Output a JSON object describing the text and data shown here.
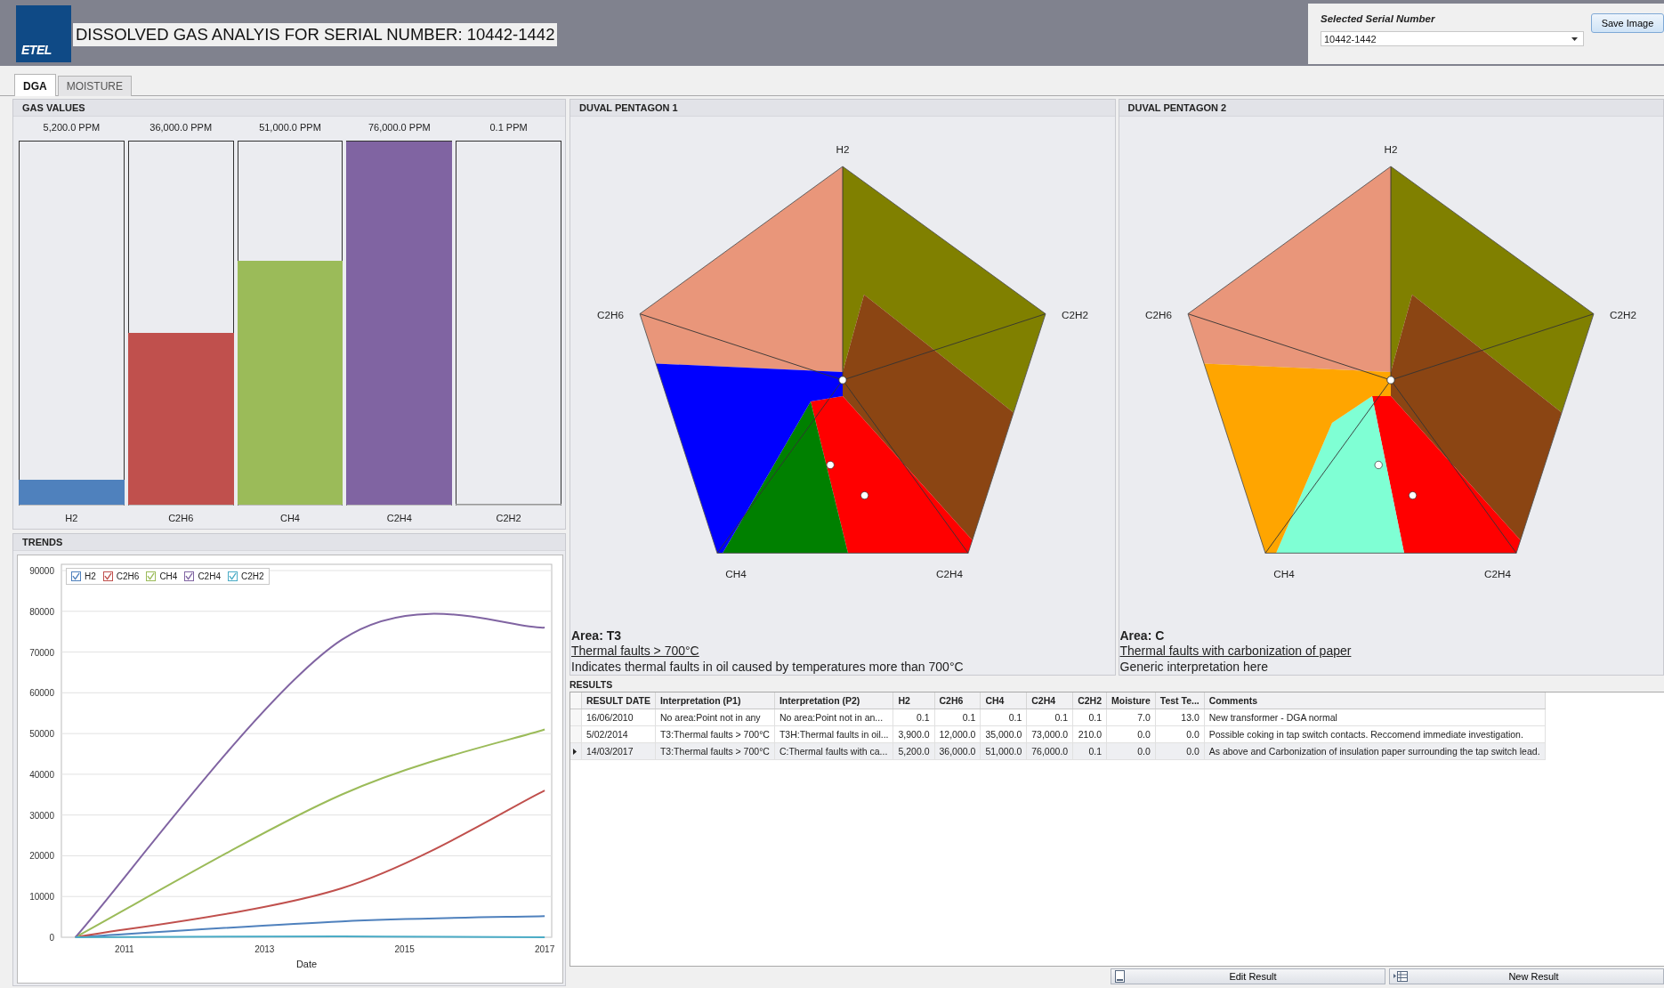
{
  "header": {
    "logo_text": "ETEL",
    "title": "DISSOLVED GAS ANALYIS FOR SERIAL NUMBER: 10442-1442",
    "serial_label": "Selected Serial Number",
    "serial_value": "10442-1442",
    "save_button": "Save Image"
  },
  "tabs": [
    {
      "label": "DGA",
      "selected": true
    },
    {
      "label": "MOISTURE",
      "selected": false
    }
  ],
  "gas_values": {
    "title": "GAS VALUES",
    "bars": [
      {
        "name": "H2",
        "reading": "5,200.0 PPM",
        "level": 0.068,
        "color": "#4f81bd"
      },
      {
        "name": "C2H6",
        "reading": "36,000.0 PPM",
        "level": 0.474,
        "color": "#c0504d"
      },
      {
        "name": "CH4",
        "reading": "51,000.0 PPM",
        "level": 0.671,
        "color": "#9bbb59"
      },
      {
        "name": "C2H4",
        "reading": "76,000.0 PPM",
        "level": 1.0,
        "color": "#8064a2"
      },
      {
        "name": "C2H2",
        "reading": "0.1 PPM",
        "level": 0.0
      }
    ]
  },
  "trends": {
    "title": "TRENDS",
    "legend": [
      {
        "checked": true
      },
      {
        "checked": true
      },
      {
        "checked": true
      },
      {
        "checked": true
      },
      {
        "checked": true
      }
    ],
    "chart_data": {
      "type": "line",
      "xlabel": "Date",
      "x": [
        2010.3,
        2014.1,
        2017.0
      ],
      "xlim": [
        2010.1,
        2017.1
      ],
      "grid": true,
      "legend": true,
      "ylim": [
        0,
        90000
      ],
      "xticks": [
        2011,
        2013,
        2015,
        2017
      ],
      "yticks": [
        0,
        10000,
        20000,
        30000,
        40000,
        50000,
        60000,
        70000,
        80000,
        90000
      ],
      "series": [
        {
          "name": "H2",
          "color": "#4f81bd",
          "values": [
            0,
            3900,
            5200
          ]
        },
        {
          "name": "C2H6",
          "color": "#c0504d",
          "values": [
            0,
            12000,
            36000
          ]
        },
        {
          "name": "CH4",
          "color": "#9bbb59",
          "values": [
            0,
            35000,
            51000
          ]
        },
        {
          "name": "C2H4",
          "color": "#8064a2",
          "values": [
            0,
            73000,
            76000
          ]
        },
        {
          "name": "C2H2",
          "color": "#4bacc6",
          "values": [
            0,
            200,
            0
          ]
        }
      ]
    }
  },
  "pentagons": [
    {
      "title": "DUVAL PENTAGON 1",
      "kind": "p1",
      "vertices": [
        "H2",
        "C2H6",
        "C2H2",
        "CH4",
        "C2H4"
      ],
      "area": "Area: T3",
      "fault": "Thermal faults > 700°C",
      "description": "Indicates thermal faults in oil caused by temperatures more than 700°C"
    },
    {
      "title": "DUVAL PENTAGON 2",
      "kind": "p2",
      "vertices": [
        "H2",
        "C2H6",
        "C2H2",
        "CH4",
        "C2H4"
      ],
      "area": "Area: C",
      "fault": "Thermal faults with carbonization of paper",
      "description": "Generic interpretation here"
    }
  ],
  "results": {
    "title": "RESULTS",
    "columns": [
      "RESULT DATE",
      "Interpretation (P1)",
      "Interpretation (P2)",
      "H2",
      "C2H6",
      "CH4",
      "C2H4",
      "C2H2",
      "Moisture",
      "Test Te...",
      "Comments"
    ],
    "rows": [
      {
        "selected": false,
        "cells": [
          "16/06/2010",
          "No area:Point not in any",
          "No area:Point not in an...",
          "0.1",
          "0.1",
          "0.1",
          "0.1",
          "0.1",
          "7.0",
          "13.0",
          "New transformer - DGA normal"
        ]
      },
      {
        "selected": false,
        "cells": [
          "5/02/2014",
          "T3:Thermal faults > 700°C",
          "T3H:Thermal faults in oil...",
          "3,900.0",
          "12,000.0",
          "35,000.0",
          "73,000.0",
          "210.0",
          "0.0",
          "0.0",
          "Possible coking in tap switch contacts. Reccomend immediate investigation."
        ]
      },
      {
        "selected": true,
        "cells": [
          "14/03/2017",
          "T3:Thermal faults > 700°C",
          "C:Thermal faults with ca...",
          "5,200.0",
          "36,000.0",
          "51,000.0",
          "76,000.0",
          "0.1",
          "0.0",
          "0.0",
          "As above and Carbonization of insulation paper surrounding the tap switch lead."
        ]
      }
    ]
  },
  "buttons": [
    {
      "label": "Edit Result",
      "kind": "edit"
    },
    {
      "label": "New Result",
      "kind": "new"
    }
  ]
}
